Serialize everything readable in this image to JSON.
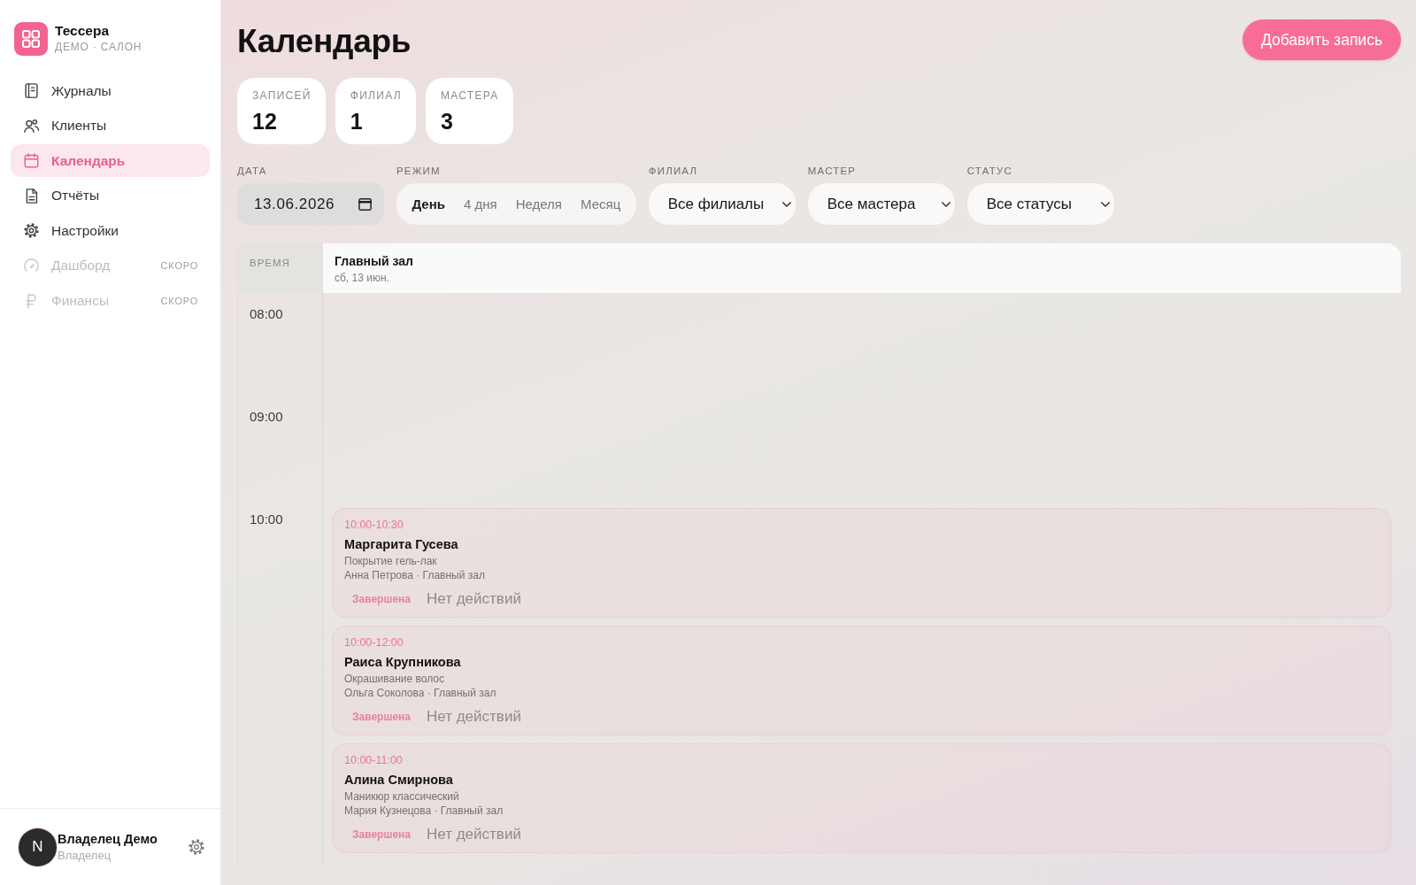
{
  "sidebar": {
    "brand": {
      "name": "Тессера",
      "subtitle": "ДЕМО · САЛОН"
    },
    "nav": [
      {
        "label": "Журналы",
        "selected": false,
        "disabled": false
      },
      {
        "label": "Клиенты",
        "selected": false,
        "disabled": false
      },
      {
        "label": "Календарь",
        "selected": true,
        "disabled": false
      },
      {
        "label": "Отчёты",
        "selected": false,
        "disabled": false
      },
      {
        "label": "Настройки",
        "selected": false,
        "disabled": false
      },
      {
        "label": "Дашборд",
        "selected": false,
        "disabled": true,
        "badge": "СКОРО"
      },
      {
        "label": "Финансы",
        "selected": false,
        "disabled": true,
        "badge": "СКОРО"
      }
    ],
    "user": {
      "avatar_text": "N",
      "name": "Владелец Демо",
      "role": "Владелец"
    }
  },
  "header": {
    "title": "Календарь",
    "add_button": "Добавить запись"
  },
  "stats": [
    {
      "label": "ЗАПИСЕЙ",
      "value": "12"
    },
    {
      "label": "ФИЛИАЛ",
      "value": "1"
    },
    {
      "label": "МАСТЕРА",
      "value": "3"
    }
  ],
  "filters": {
    "date": {
      "label": "ДАТА",
      "value": "13.06.2026"
    },
    "mode": {
      "label": "РЕЖИМ",
      "options": [
        {
          "label": "День",
          "selected": true
        },
        {
          "label": "4 дня",
          "selected": false
        },
        {
          "label": "Неделя",
          "selected": false
        },
        {
          "label": "Месяц",
          "selected": false
        }
      ]
    },
    "selects": [
      {
        "label": "ФИЛИАЛ",
        "value": "Все филиалы"
      },
      {
        "label": "МАСТЕР",
        "value": "Все мастера"
      },
      {
        "label": "СТАТУС",
        "value": "Все статусы"
      }
    ]
  },
  "calendar": {
    "time_header": "ВРЕМЯ",
    "column": {
      "title": "Главный зал",
      "date": "сб, 13 июн."
    },
    "hours": [
      {
        "time": "08:00"
      },
      {
        "time": "09:00"
      },
      {
        "time": "10:00",
        "appointments": [
          {
            "time": "10:00-10:30",
            "client": "Маргарита Гусева",
            "service": "Покрытие гель-лак",
            "details": "Анна Петрова · Главный зал",
            "status": "Завершена",
            "actions": "Нет действий"
          },
          {
            "time": "10:00-12:00",
            "client": "Раиса Крупникова",
            "service": "Окрашивание волос",
            "details": "Ольга Соколова · Главный зал",
            "status": "Завершена",
            "actions": "Нет действий"
          },
          {
            "time": "10:00-11:00",
            "client": "Алина Смирнова",
            "service": "Маникюр классический",
            "details": "Мария Кузнецова · Главный зал",
            "status": "Завершена",
            "actions": "Нет действий"
          }
        ]
      }
    ]
  }
}
